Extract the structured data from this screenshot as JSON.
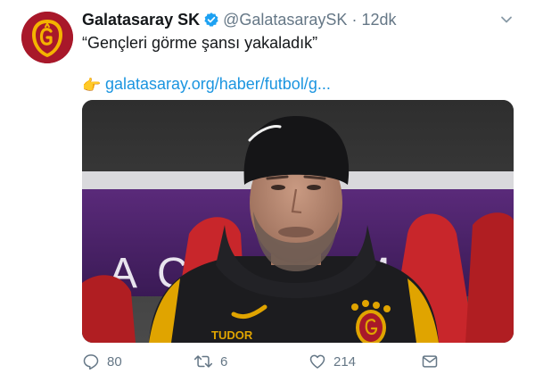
{
  "tweet": {
    "author_name": "Galatasaray SK",
    "handle": "@GalatasaraySK",
    "separator": "·",
    "time": "12dk",
    "text": "“Gençleri görme şansı yakaladık”",
    "link_emoji": "👉",
    "link_text": "galatasaray.org/haber/futbol/g..."
  },
  "media": {
    "jersey_text": "TUDOR",
    "banner_text": "ACADEMY"
  },
  "actions": {
    "reply_count": "80",
    "retweet_count": "6",
    "like_count": "214"
  },
  "colors": {
    "text": "#14171a",
    "muted": "#657786",
    "link": "#1b95e0",
    "verified": "#1da1f2",
    "brand_red": "#a8182a",
    "brand_yellow": "#f4b400"
  }
}
